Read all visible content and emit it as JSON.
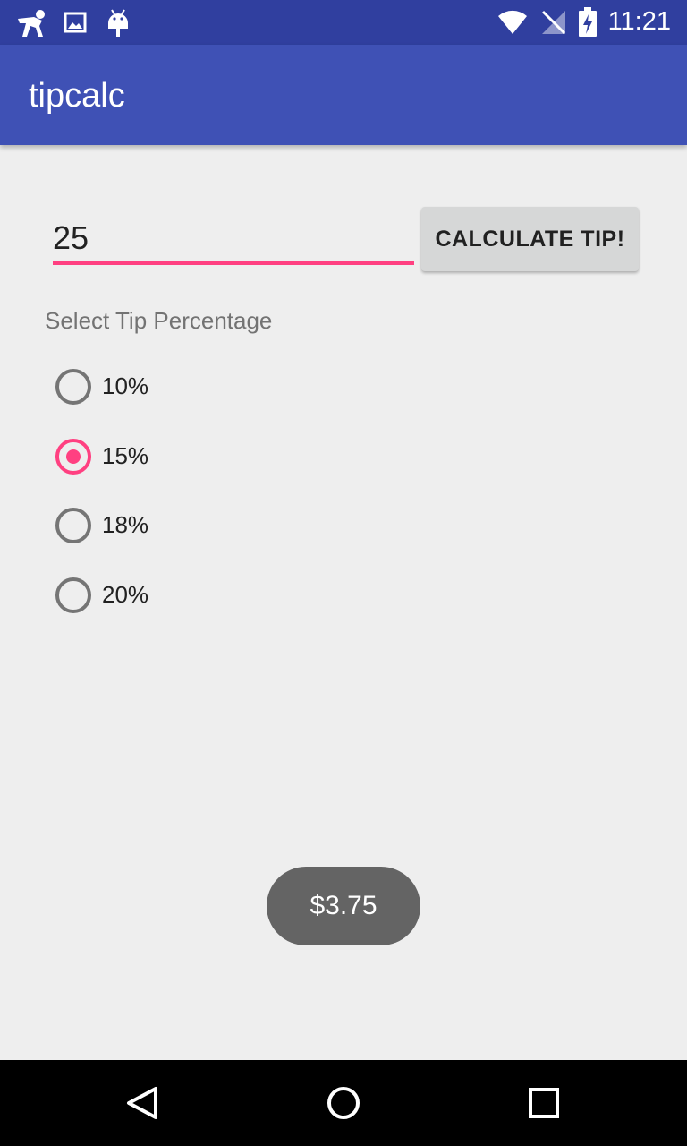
{
  "status_bar": {
    "time": "11:21",
    "left_icons": [
      "runner-notification-icon",
      "image-notification-icon",
      "android-notification-icon"
    ],
    "right_icons": [
      "wifi-icon",
      "no-signal-icon",
      "battery-charging-icon"
    ]
  },
  "app_bar": {
    "title": "tipcalc"
  },
  "bill_input": {
    "value": "25"
  },
  "calculate_button": {
    "label": "CALCULATE TIP!"
  },
  "tip_section": {
    "label": "Select Tip Percentage",
    "options": [
      {
        "label": "10%",
        "checked": false
      },
      {
        "label": "15%",
        "checked": true
      },
      {
        "label": "18%",
        "checked": false
      },
      {
        "label": "20%",
        "checked": false
      }
    ]
  },
  "toast": {
    "text": "$3.75"
  },
  "nav_bar": {
    "buttons": [
      "back-icon",
      "home-icon",
      "recents-icon"
    ]
  },
  "colors": {
    "primary": "#3f51b5",
    "primary_dark": "#303f9f",
    "accent": "#ff4081",
    "background": "#eeeeee"
  }
}
